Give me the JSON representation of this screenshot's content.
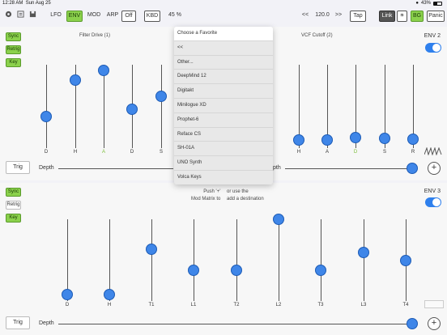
{
  "status": {
    "time": "12:28 AM",
    "date": "Sun Aug 25",
    "battery": "43%"
  },
  "toolbar": {
    "lfo": "LFO",
    "env": "ENV",
    "mod": "MOD",
    "arp": "ARP",
    "off": "Off",
    "kbd": "KBD",
    "zoom": "45 %",
    "prev": "<<",
    "tempo": "120.0",
    "next": ">>",
    "tap": "Tap",
    "link": "Link",
    "bg": "BG",
    "panic": "Panic"
  },
  "env2": {
    "label": "ENV 2",
    "buttons": {
      "sync": "Sync",
      "retrig": "Retrig",
      "key": "Key"
    },
    "left_title": "Filter Drive (1)",
    "right_title": "VCF Cutoff (2)",
    "left_sliders": [
      {
        "label": "D",
        "value": 0.38,
        "highlight": false
      },
      {
        "label": "H",
        "value": 0.82,
        "highlight": false
      },
      {
        "label": "A",
        "value": 0.93,
        "highlight": true
      },
      {
        "label": "D",
        "value": 0.47,
        "highlight": false
      },
      {
        "label": "S",
        "value": 0.62,
        "highlight": false
      }
    ],
    "right_sliders": [
      {
        "label": "H",
        "value": 0.1,
        "highlight": false
      },
      {
        "label": "A",
        "value": 0.1,
        "highlight": false
      },
      {
        "label": "D",
        "value": 0.13,
        "highlight": true
      },
      {
        "label": "S",
        "value": 0.12,
        "highlight": false
      },
      {
        "label": "R",
        "value": 0.11,
        "highlight": false
      }
    ],
    "trig": "Trig",
    "depth": "Depth",
    "depth_right": "pth"
  },
  "env3": {
    "label": "ENV 3",
    "buttons": {
      "sync": "Sync",
      "retrig": "Retrig",
      "key": "Key"
    },
    "hint_left": "Push '+'\nMod Matrix to",
    "hint_right": "or use the\nadd a destination",
    "sliders": [
      {
        "label": "D",
        "value": 0.08
      },
      {
        "label": "H",
        "value": 0.08
      },
      {
        "label": "T1",
        "value": 0.63
      },
      {
        "label": "L1",
        "value": 0.38
      },
      {
        "label": "T2",
        "value": 0.38
      },
      {
        "label": "L2",
        "value": 1.0
      },
      {
        "label": "T3",
        "value": 0.38
      },
      {
        "label": "L3",
        "value": 0.59
      },
      {
        "label": "T4",
        "value": 0.5
      }
    ],
    "trig": "Trig",
    "depth": "Depth"
  },
  "menu": {
    "items": [
      "Choose a Favorite",
      "<<",
      "Other...",
      "DeepMind 12",
      "Digitakt",
      "Minilogue XD",
      "Prophet-6",
      "Reface CS",
      "SH-01A",
      "UNO Synth",
      "Volca Keys"
    ]
  },
  "colors": {
    "accent": "#3f86e8",
    "green": "#8bd14c",
    "highlight_label": "#7cbf3a"
  }
}
